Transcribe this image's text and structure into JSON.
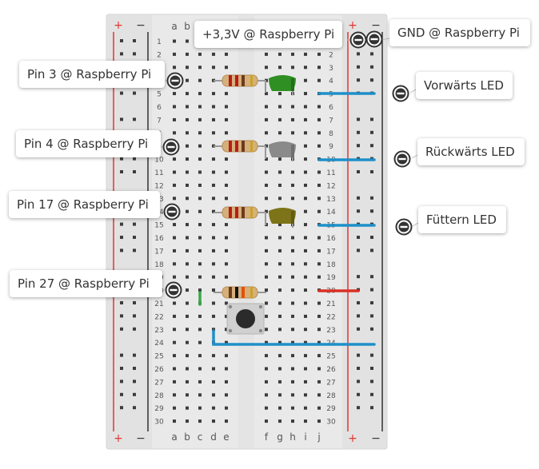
{
  "board": {
    "rail_plus": "+",
    "rail_minus": "−",
    "columns_left": [
      "a",
      "b",
      "c",
      "d",
      "e"
    ],
    "columns_right": [
      "f",
      "g",
      "h",
      "i",
      "j"
    ],
    "row_numbers": [
      "1",
      "2",
      "3",
      "4",
      "5",
      "6",
      "7",
      "8",
      "9",
      "10",
      "11",
      "12",
      "13",
      "14",
      "15",
      "16",
      "17",
      "18",
      "19",
      "20",
      "21",
      "22",
      "23",
      "24",
      "25",
      "26",
      "27",
      "28",
      "29",
      "30"
    ]
  },
  "labels": {
    "vcc": "+3,3V @ Raspberry Pi",
    "gnd": "GND @ Raspberry Pi",
    "pin3": "Pin 3 @ Raspberry Pi",
    "pin4": "Pin 4 @ Raspberry Pi",
    "pin17": "Pin 17 @ Raspberry Pi",
    "pin27": "Pin 27 @ Raspberry Pi",
    "led_forward": "Vorwärts LED",
    "led_backward": "Rückwärts LED",
    "led_feed": "Füttern LED"
  },
  "colors": {
    "board": "#e9e9e9",
    "hole": "#3c3c3c",
    "rail_red": "#e3342f",
    "rail_black": "#333333",
    "wire_blue": "#1e8fc9",
    "wire_red": "#d93025",
    "wire_green": "#3aa845",
    "led_green": "#2f8f23",
    "led_grey": "#8a8a8a",
    "led_olive": "#7d7318"
  },
  "icons": [
    "connector-icon",
    "resistor-icon",
    "led-icon",
    "pushbutton-icon"
  ]
}
